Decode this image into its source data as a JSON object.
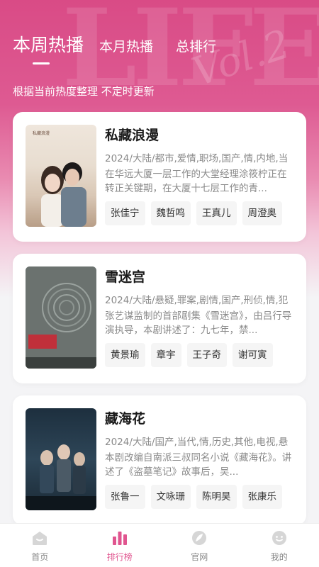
{
  "tabs": {
    "weekly": "本周热播",
    "monthly": "本月热播",
    "overall": "总排行"
  },
  "subtitle": "根据当前热度整理 不定时更新",
  "colors": {
    "accent": "#e0558f",
    "hero": "#d94b86"
  },
  "shows": [
    {
      "title": "私藏浪漫",
      "meta": "2024/大陆/都市,爱情,职场,国产,情,内地,当",
      "desc": "在华远大厦一层工作的大堂经理涂筱柠正在转正关键期，在大厦十七层工作的青...",
      "actors": [
        "张佳宁",
        "魏哲鸣",
        "王真儿",
        "周澄奥"
      ]
    },
    {
      "title": "雪迷宫",
      "meta": "2024/大陆/悬疑,罪案,剧情,国产,刑侦,情,犯",
      "desc": "张艺谋监制的首部剧集《雪迷宫》，由吕行导演执导，本剧讲述了：九七年，禁...",
      "actors": [
        "黄景瑜",
        "章宇",
        "王子奇",
        "谢可寅"
      ]
    },
    {
      "title": "藏海花",
      "meta": "2024/大陆/国产,当代,情,历史,其他,电视,悬",
      "desc": "本剧改编自南派三叔同名小说《藏海花》。讲述了《盗墓笔记》故事后，吴...",
      "actors": [
        "张鲁一",
        "文咏珊",
        "陈明昊",
        "张康乐"
      ]
    }
  ],
  "tabbar": {
    "home": "首页",
    "ranking": "排行榜",
    "site": "官网",
    "mine": "我的"
  }
}
